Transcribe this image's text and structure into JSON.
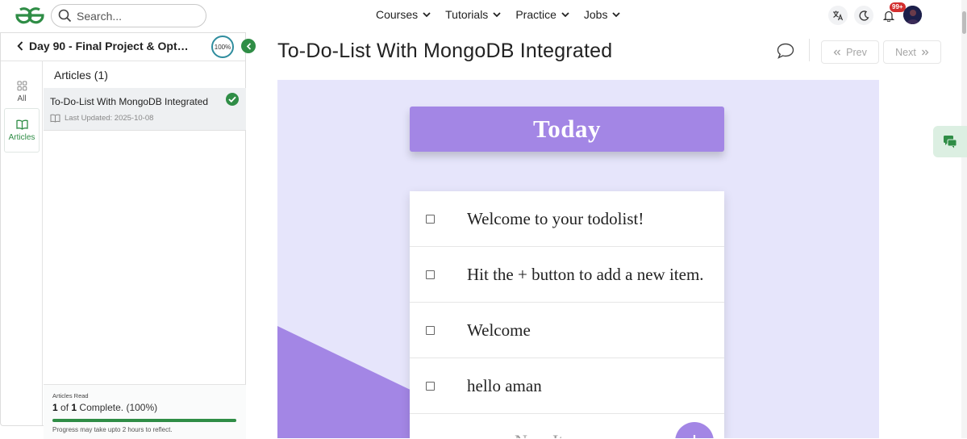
{
  "header": {
    "search_placeholder": "Search...",
    "nav": [
      "Courses",
      "Tutorials",
      "Practice",
      "Jobs"
    ],
    "notification_count": "99+"
  },
  "sidebar": {
    "title": "Day 90 - Final Project & Optim...",
    "progress": "100%",
    "rail": [
      {
        "label": "All",
        "icon": "grid-icon"
      },
      {
        "label": "Articles",
        "icon": "book-icon"
      }
    ],
    "section_heading": "Articles (1)",
    "articles": [
      {
        "title": "To-Do-List With MongoDB Integrated",
        "updated": "Last Updated: 2025-10-08",
        "completed": true
      }
    ],
    "footer": {
      "label": "Articles Read",
      "done": "1",
      "of_text": "of",
      "total": "1",
      "status": "Complete. (100%)",
      "progress_percent": 100,
      "note": "Progress may take upto 2 hours to reflect."
    }
  },
  "main": {
    "title": "To-Do-List With MongoDB Integrated",
    "prev_label": "Prev",
    "next_label": "Next",
    "image": {
      "heading": "Today",
      "items": [
        "Welcome to your todolist!",
        "Hit the + button to add a new item.",
        "Welcome",
        "hello aman"
      ],
      "new_item_text": "New Item",
      "add_symbol": "+"
    }
  },
  "colors": {
    "brand_green": "#2f8d46",
    "accent_purple": "#a386e5",
    "image_bg": "#e6e5fb"
  }
}
